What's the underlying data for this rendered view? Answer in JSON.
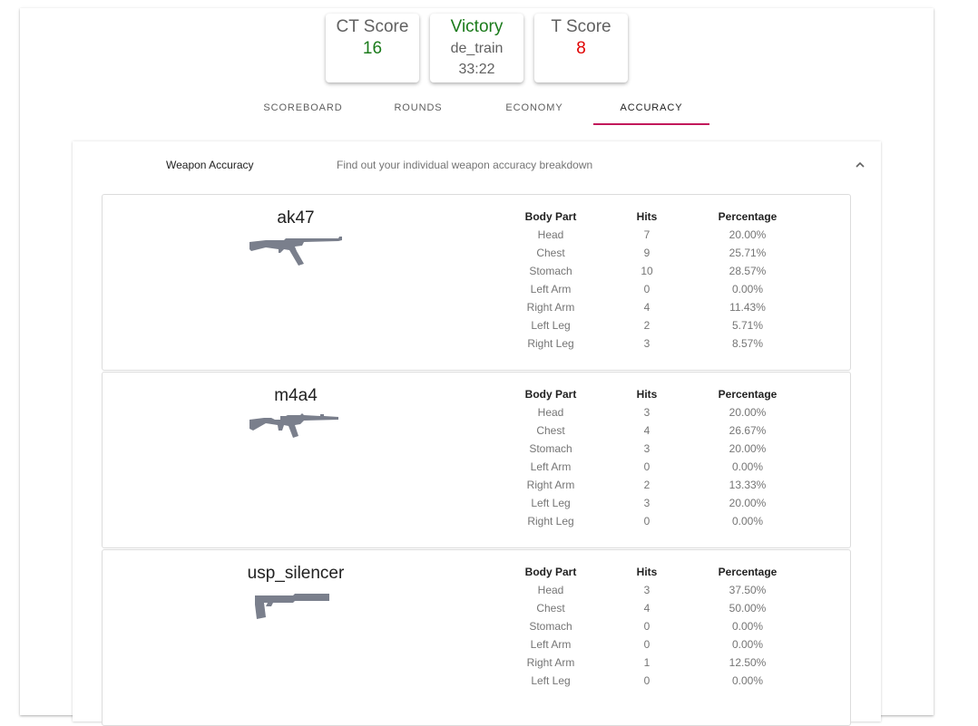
{
  "scores": {
    "ct": {
      "label": "CT Score",
      "value": "16",
      "color": "#1b7b1b"
    },
    "result": {
      "label": "Victory",
      "map": "de_train",
      "duration": "33:22",
      "color": "#1b7b1b"
    },
    "t": {
      "label": "T Score",
      "value": "8",
      "color": "#e00000"
    }
  },
  "tabs": [
    {
      "label": "SCOREBOARD"
    },
    {
      "label": "ROUNDS"
    },
    {
      "label": "ECONOMY"
    },
    {
      "label": "ACCURACY"
    }
  ],
  "active_tab": "ACCURACY",
  "accent_color": "#c2185b",
  "panel": {
    "title": "Weapon Accuracy",
    "description": "Find out your individual weapon accuracy breakdown",
    "toggle_icon": "chevron-up-icon"
  },
  "table_headers": {
    "part": "Body Part",
    "hits": "Hits",
    "pct": "Percentage"
  },
  "weapons": [
    {
      "name": "ak47",
      "icon": "ak47-rifle-icon",
      "rows": [
        {
          "part": "Head",
          "hits": "7",
          "pct": "20.00%"
        },
        {
          "part": "Chest",
          "hits": "9",
          "pct": "25.71%"
        },
        {
          "part": "Stomach",
          "hits": "10",
          "pct": "28.57%"
        },
        {
          "part": "Left Arm",
          "hits": "0",
          "pct": "0.00%"
        },
        {
          "part": "Right Arm",
          "hits": "4",
          "pct": "11.43%"
        },
        {
          "part": "Left Leg",
          "hits": "2",
          "pct": "5.71%"
        },
        {
          "part": "Right Leg",
          "hits": "3",
          "pct": "8.57%"
        }
      ]
    },
    {
      "name": "m4a4",
      "icon": "m4a4-rifle-icon",
      "rows": [
        {
          "part": "Head",
          "hits": "3",
          "pct": "20.00%"
        },
        {
          "part": "Chest",
          "hits": "4",
          "pct": "26.67%"
        },
        {
          "part": "Stomach",
          "hits": "3",
          "pct": "20.00%"
        },
        {
          "part": "Left Arm",
          "hits": "0",
          "pct": "0.00%"
        },
        {
          "part": "Right Arm",
          "hits": "2",
          "pct": "13.33%"
        },
        {
          "part": "Left Leg",
          "hits": "3",
          "pct": "20.00%"
        },
        {
          "part": "Right Leg",
          "hits": "0",
          "pct": "0.00%"
        }
      ]
    },
    {
      "name": "usp_silencer",
      "icon": "usp-pistol-icon",
      "rows": [
        {
          "part": "Head",
          "hits": "3",
          "pct": "37.50%"
        },
        {
          "part": "Chest",
          "hits": "4",
          "pct": "50.00%"
        },
        {
          "part": "Stomach",
          "hits": "0",
          "pct": "0.00%"
        },
        {
          "part": "Left Arm",
          "hits": "0",
          "pct": "0.00%"
        },
        {
          "part": "Right Arm",
          "hits": "1",
          "pct": "12.50%"
        },
        {
          "part": "Left Leg",
          "hits": "0",
          "pct": "0.00%"
        }
      ]
    }
  ]
}
